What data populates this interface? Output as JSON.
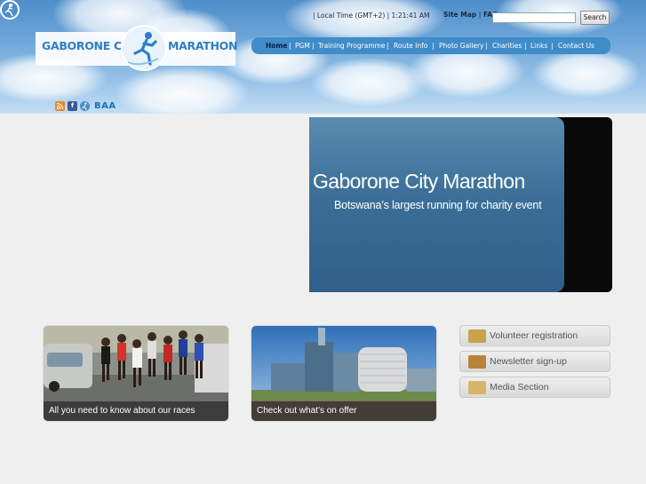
{
  "header": {
    "logo_left": "GABORONE CITY",
    "logo_right": "MARATHON",
    "local_time": "| Local Time (GMT+2) | 1:21:41 AM",
    "site_map": "Site Map",
    "separator": "|",
    "faq": "FAQ",
    "search_button": "Search",
    "search_value": ""
  },
  "nav": {
    "items": [
      "Home",
      "PGM",
      "Training  Programme",
      "Route Info",
      "Photo Gallery",
      "Charities",
      "Links",
      "Contact Us"
    ]
  },
  "social": {
    "rss": "RSS",
    "facebook": "f",
    "baa": "BAA"
  },
  "banner": {
    "title": "Gaborone City Marathon",
    "subtitle": "Botswana’s largest running for charity event"
  },
  "cards": [
    {
      "caption": "All you need to know about our races"
    },
    {
      "caption": "Check out what’s on offer"
    }
  ],
  "side_buttons": [
    {
      "label": "Volunteer registration"
    },
    {
      "label": "Newsletter sign-up"
    },
    {
      "label": "Media Section"
    }
  ],
  "colors": {
    "nav_bg": "#3f8cc9",
    "logo_blue": "#2d7ec2",
    "banner_blue": "#3b6f98"
  }
}
